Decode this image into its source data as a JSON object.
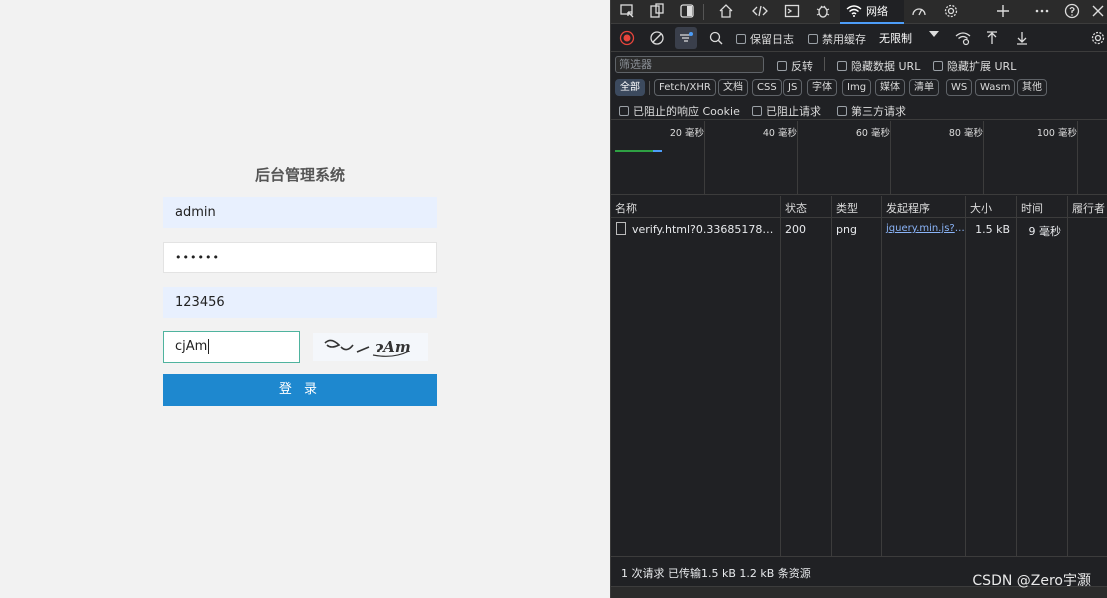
{
  "login": {
    "title": "后台管理系统",
    "username": "admin",
    "password_mask": "••••••",
    "code_field": "123456",
    "captcha_input": "cjAm",
    "captcha_image_text": "cjAm",
    "login_button": "登 录"
  },
  "devtools": {
    "network_tab_label": "网络",
    "toolbar": {
      "preserve_log": "保留日志",
      "disable_cache": "禁用缓存",
      "throttling": "无限制"
    },
    "filter": {
      "placeholder": "筛选器",
      "invert": "反转",
      "hide_data_urls": "隐藏数据 URL",
      "hide_extension_urls": "隐藏扩展 URL"
    },
    "types": [
      "全部",
      "Fetch/XHR",
      "文档",
      "CSS",
      "JS",
      "字体",
      "Img",
      "媒体",
      "清单",
      "WS",
      "Wasm",
      "其他"
    ],
    "blocked": {
      "blocked_cookies": "已阻止的响应 Cookie",
      "blocked_requests": "已阻止请求",
      "third_party": "第三方请求"
    },
    "overview_ticks": [
      "20 毫秒",
      "40 毫秒",
      "60 毫秒",
      "80 毫秒",
      "100 毫秒"
    ],
    "columns": [
      "名称",
      "状态",
      "类型",
      "发起程序",
      "大小",
      "时间",
      "履行者"
    ],
    "rows": [
      {
        "name": "verify.html?0.336851784910...",
        "status": "200",
        "type": "png",
        "initiator": "jquery.min.js?v=...",
        "size": "1.5 kB",
        "time": "9 毫秒",
        "fulfilled": ""
      }
    ],
    "status_bar": "1 次请求  已传输1.5 kB  1.2 kB 条资源"
  },
  "watermark": "CSDN @Zero宇灏",
  "colors": {
    "login_button": "#1e88cf",
    "devtools_bg": "#202124",
    "accent": "#4d9df8"
  }
}
